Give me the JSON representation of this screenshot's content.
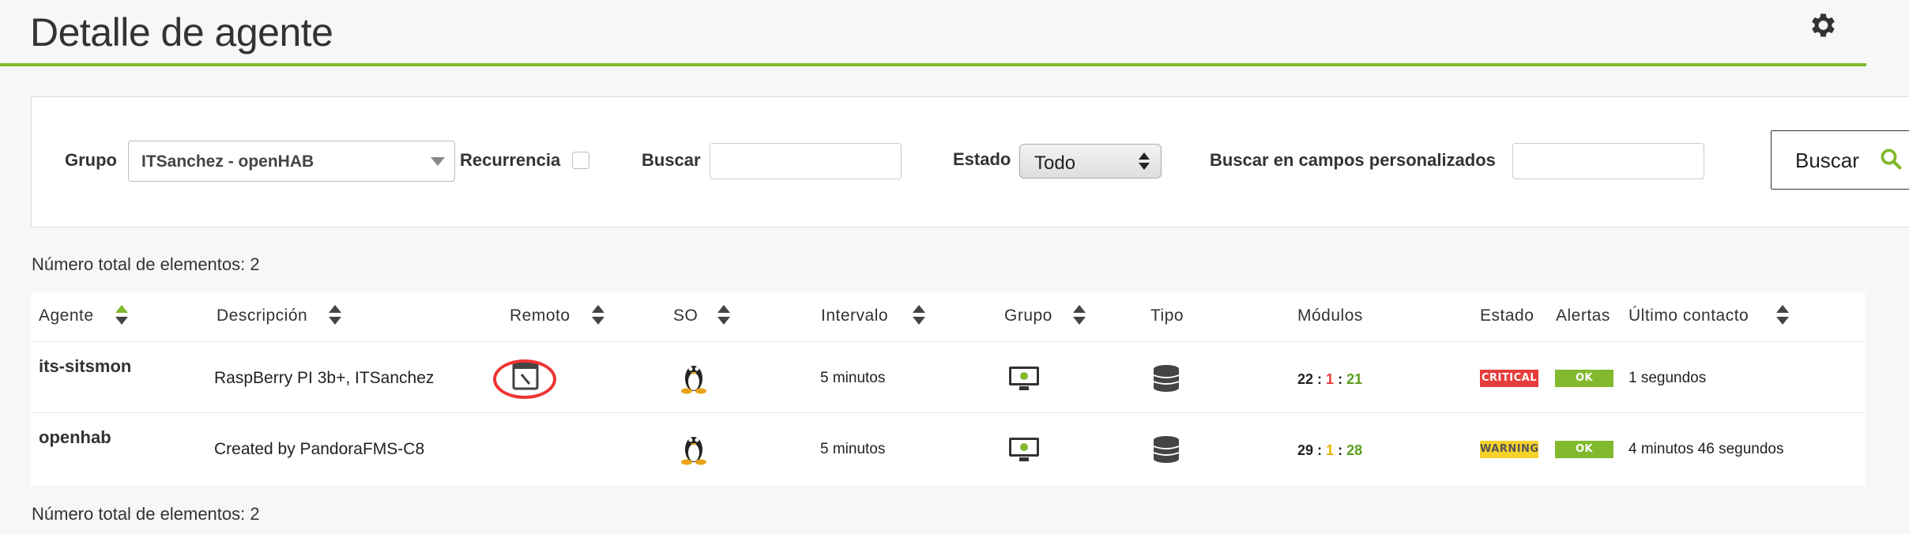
{
  "header": {
    "title": "Detalle de agente",
    "settings_icon": "gear-icon"
  },
  "filters": {
    "grupo_label": "Grupo",
    "grupo_value": "ITSanchez - openHAB",
    "recurrencia_label": "Recurrencia",
    "buscar_label": "Buscar",
    "buscar_value": "",
    "estado_label": "Estado",
    "estado_value": "Todo",
    "custom_label": "Buscar en campos personalizados",
    "custom_value": "",
    "search_button": "Buscar"
  },
  "total_top": "Número total de elementos: 2",
  "total_bottom": "Número total de elementos: 2",
  "table": {
    "columns": {
      "agente": "Agente",
      "descripcion": "Descripción",
      "remoto": "Remoto",
      "so": "SO",
      "intervalo": "Intervalo",
      "grupo": "Grupo",
      "tipo": "Tipo",
      "modulos": "Módulos",
      "estado": "Estado",
      "alertas": "Alertas",
      "ultimo": "Último contacto"
    },
    "rows": [
      {
        "agent": "its-sitsmon",
        "description": "RaspBerry PI 3b+, ITSanchez",
        "interval": "5 minutos",
        "modules": {
          "total": "22",
          "critical": "1",
          "ok": "21"
        },
        "status": "CRITICAL",
        "alert": "OK",
        "last_contact": "1 segundos"
      },
      {
        "agent": "openhab",
        "description": "Created by PandoraFMS-C8",
        "interval": "5 minutos",
        "modules": {
          "total": "29",
          "warning": "1",
          "ok": "28"
        },
        "status": "WARNING",
        "alert": "OK",
        "last_contact": "4 minutos 46 segundos"
      }
    ]
  },
  "colors": {
    "accent": "#82b92e",
    "critical": "#e63c3c",
    "warning": "#f5d22a",
    "ok": "#82b92e"
  }
}
